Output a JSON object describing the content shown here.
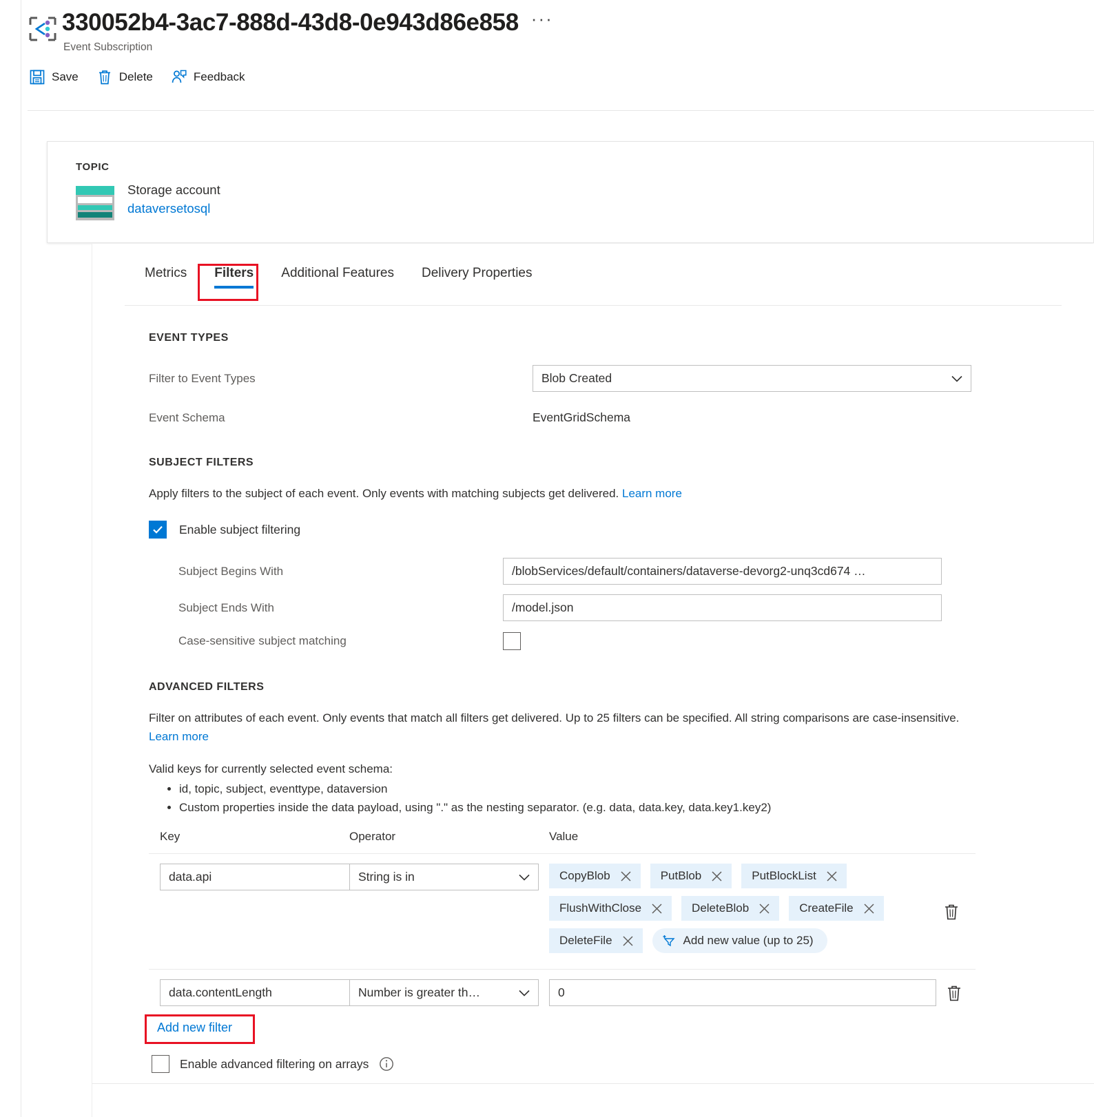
{
  "header": {
    "title": "330052b4-3ac7-888d-43d8-0e943d86e858",
    "subtitle": "Event Subscription",
    "more_label": "···",
    "commands": [
      {
        "label": "Save",
        "icon": "save-icon"
      },
      {
        "label": "Delete",
        "icon": "trash-icon"
      },
      {
        "label": "Feedback",
        "icon": "feedback-icon"
      }
    ]
  },
  "topic": {
    "label": "TOPIC",
    "resource_type": "Storage account",
    "resource_name": "dataversetosql",
    "icon": "storage-account-icon"
  },
  "tabs": [
    {
      "label": "Metrics",
      "active": false
    },
    {
      "label": "Filters",
      "active": true
    },
    {
      "label": "Additional Features",
      "active": false
    },
    {
      "label": "Delivery Properties",
      "active": false
    }
  ],
  "event_types": {
    "section_title": "EVENT TYPES",
    "filter_label": "Filter to Event Types",
    "filter_value": "Blob Created",
    "schema_label": "Event Schema",
    "schema_value": "EventGridSchema"
  },
  "subject_filters": {
    "section_title": "SUBJECT FILTERS",
    "description": "Apply filters to the subject of each event. Only events with matching subjects get delivered.",
    "learn_more": "Learn more",
    "enable_label": "Enable subject filtering",
    "enable_checked": true,
    "begins_with_label": "Subject Begins With",
    "begins_with_value": "/blobServices/default/containers/dataverse-devorg2-unq3cd674 …",
    "ends_with_label": "Subject Ends With",
    "ends_with_value": "/model.json",
    "case_sensitive_label": "Case-sensitive subject matching",
    "case_sensitive_checked": false
  },
  "advanced_filters": {
    "section_title": "ADVANCED FILTERS",
    "description": "Filter on attributes of each event. Only events that match all filters get delivered. Up to 25 filters can be specified. All string comparisons are case-insensitive.",
    "learn_more": "Learn more",
    "valid_keys_intro": "Valid keys for currently selected event schema:",
    "valid_keys_bullets": [
      "id, topic, subject, eventtype, dataversion",
      "Custom properties inside the data payload, using \".\" as the nesting separator. (e.g. data, data.key, data.key1.key2)"
    ],
    "columns": {
      "key": "Key",
      "operator": "Operator",
      "value": "Value"
    },
    "rows": [
      {
        "key": "data.api",
        "operator": "String is in",
        "value_type": "chips",
        "chips": [
          "CopyBlob",
          "PutBlob",
          "PutBlockList",
          "FlushWithClose",
          "DeleteBlob",
          "CreateFile",
          "DeleteFile"
        ],
        "add_value_label": "Add new value (up to 25)"
      },
      {
        "key": "data.contentLength",
        "operator": "Number is greater th…",
        "value_type": "input",
        "value": "0"
      }
    ],
    "add_new_filter": "Add new filter",
    "arrays_label": "Enable advanced filtering on arrays",
    "arrays_checked": false
  },
  "colors": {
    "accent": "#0078d4",
    "annotation": "#e81123",
    "chip_bg": "#e5f1fb",
    "storage_teal": "#32c8b4",
    "storage_teal_dark": "#128378"
  }
}
